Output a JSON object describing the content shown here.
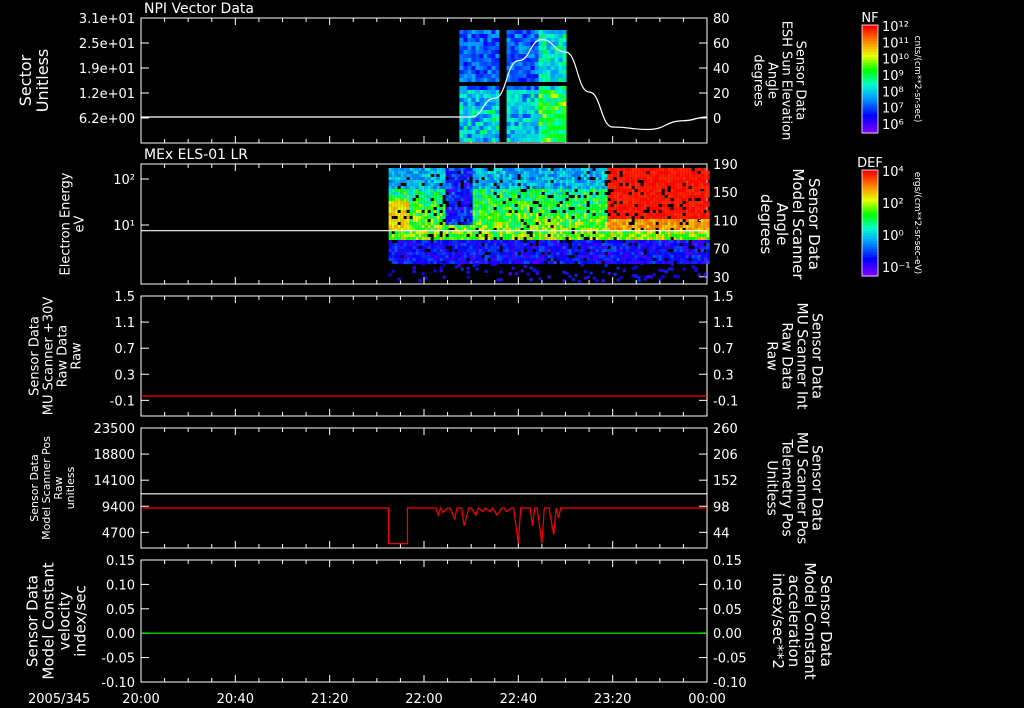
{
  "time_axis": {
    "date": "2005/345",
    "ticks": [
      "20:00",
      "20:40",
      "21:20",
      "22:00",
      "22:40",
      "23:20",
      "00:00"
    ]
  },
  "colors": {
    "panel_line": "#ffffff",
    "red": "#ff0000",
    "green": "#00ff00"
  },
  "chart_data": [
    {
      "type": "heatmap",
      "title": "NPI Vector Data",
      "ylabel_left": [
        "Sector",
        "Unitless"
      ],
      "yticks_left": [
        "3.1e+01",
        "2.5e+01",
        "1.9e+01",
        "1.2e+01",
        "6.2e+00"
      ],
      "ylabel_right": [
        "Sensor Data",
        "ESH Sun Elevation",
        "Angle",
        "degrees"
      ],
      "yticks_right": [
        "80",
        "60",
        "40",
        "20",
        "0"
      ],
      "ylim_right": [
        -20,
        80
      ],
      "colorbar": {
        "label": "NF",
        "unit": "cnts/(cm**2-sr-sec)",
        "ticks": [
          "10¹²",
          "10¹¹",
          "10¹⁰",
          "10⁹",
          "10⁸",
          "10⁷",
          "10⁶"
        ]
      },
      "data_extent": [
        "22:15",
        "23:00"
      ],
      "overlay_line": {
        "name": "ESH Sun Elevation Angle",
        "x": [
          "20:00",
          "22:20",
          "22:30",
          "22:40",
          "22:50",
          "23:00",
          "23:10",
          "23:20",
          "23:35",
          "23:50",
          "00:00"
        ],
        "y": [
          0,
          0,
          15,
          45,
          62,
          52,
          20,
          -8,
          -10,
          -3,
          0
        ]
      }
    },
    {
      "type": "heatmap",
      "title": "MEx ELS-01 LR",
      "ylabel_left": [
        "Electron Energy",
        "eV"
      ],
      "yticks_left": [
        "10²",
        "10¹"
      ],
      "ylabel_right": [
        "Sensor Data",
        "Model Scanner",
        "Angle",
        "degrees"
      ],
      "yticks_right": [
        "190",
        "150",
        "110",
        "70",
        "30"
      ],
      "ylim_right": [
        10,
        190
      ],
      "colorbar": {
        "label": "DEF",
        "unit": "ergs/(cm**2-sr-sec-eV)",
        "ticks": [
          "10⁴",
          "10²",
          "10⁰",
          "10⁻¹"
        ]
      },
      "data_extent": [
        "21:45",
        "00:00"
      ],
      "overlay_line": {
        "name": "Model Scanner Angle",
        "x": [
          "20:00",
          "00:00"
        ],
        "y": [
          90,
          90
        ]
      }
    },
    {
      "type": "line",
      "ylabel_left": [
        "Sensor Data",
        "MU Scanner +30V",
        "Raw Data",
        "Raw"
      ],
      "yticks_left": [
        "1.5",
        "1.1",
        "0.7",
        "0.3",
        "-0.1"
      ],
      "ylabel_right": [
        "Sensor Data",
        "MU Scanner Int",
        "Raw Data",
        "Raw"
      ],
      "yticks_right": [
        "1.5",
        "1.1",
        "0.7",
        "0.3",
        "-0.1"
      ],
      "ylim": [
        -0.3,
        1.5
      ],
      "series": [
        {
          "name": "MU Scanner Int Raw Data",
          "x": [
            "20:00",
            "00:00"
          ],
          "y": [
            0.0,
            0.0
          ]
        }
      ]
    },
    {
      "type": "line",
      "ylabel_left": [
        "Sensor Data",
        "Model Scanner Pos",
        "Raw",
        "unitless"
      ],
      "yticks_left": [
        "23500",
        "18800",
        "14100",
        "9400",
        "4700"
      ],
      "ylabel_right": [
        "Sensor Data",
        "MU Scanner Pos",
        "Telemetry Pos",
        "Unitless"
      ],
      "yticks_right": [
        "260",
        "206",
        "152",
        "98",
        "44"
      ],
      "ylim_right": [
        -10,
        260
      ],
      "series": [
        {
          "name": "Model Scanner Pos",
          "x": [
            "20:00",
            "00:00"
          ],
          "y": [
            112,
            112
          ]
        },
        {
          "name": "MU Scanner Pos Telemetry Pos",
          "x": [
            "20:00",
            "21:45",
            "21:45",
            "21:53",
            "21:53",
            "22:05",
            "22:06",
            "22:07",
            "22:08",
            "22:10",
            "22:11",
            "22:13",
            "22:14",
            "22:16",
            "22:17",
            "22:19",
            "22:20",
            "22:22",
            "22:23",
            "22:25",
            "22:26",
            "22:28",
            "22:29",
            "22:31",
            "22:33",
            "22:34",
            "22:35",
            "22:37",
            "22:38",
            "22:40",
            "22:41",
            "22:42",
            "22:45",
            "22:46",
            "22:47",
            "22:48",
            "22:50",
            "22:51",
            "22:53",
            "22:55",
            "22:56",
            "22:57",
            "22:58",
            "00:00"
          ],
          "y": [
            80,
            80,
            0,
            0,
            80,
            80,
            64,
            80,
            70,
            80,
            80,
            56,
            80,
            80,
            40,
            80,
            80,
            64,
            80,
            72,
            80,
            72,
            80,
            64,
            80,
            80,
            72,
            80,
            80,
            0,
            80,
            80,
            80,
            40,
            80,
            80,
            0,
            80,
            80,
            20,
            80,
            58,
            80,
            80
          ]
        }
      ]
    },
    {
      "type": "line",
      "ylabel_left": [
        "Sensor Data",
        "Model Constant",
        "velocity",
        "index/sec"
      ],
      "yticks_left": [
        "0.15",
        "0.10",
        "0.05",
        "0.00",
        "-0.05",
        "-0.10"
      ],
      "ylabel_right": [
        "Sensor Data",
        "Model Constant",
        "acceleration",
        "index/sec**2"
      ],
      "yticks_right": [
        "0.15",
        "0.10",
        "0.05",
        "0.00",
        "-0.05",
        "-0.10"
      ],
      "ylim": [
        -0.1,
        0.15
      ],
      "series": [
        {
          "name": "Model Constant acceleration",
          "x": [
            "20:00",
            "00:00"
          ],
          "y": [
            0.0,
            0.0
          ]
        }
      ]
    }
  ]
}
